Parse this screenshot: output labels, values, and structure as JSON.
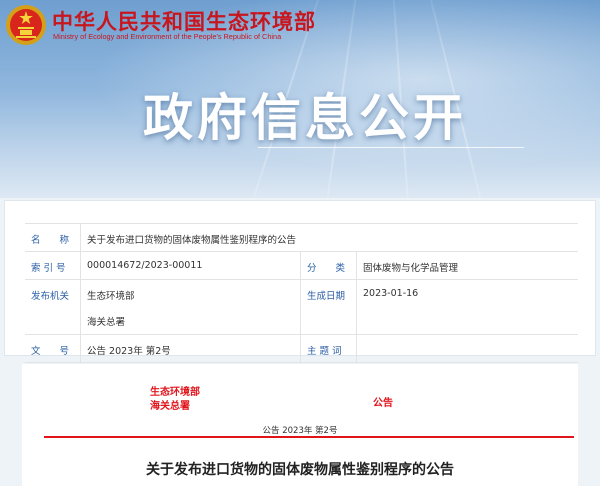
{
  "header": {
    "ministry_cn": "中华人民共和国生态环境部",
    "ministry_en": "Ministry of Ecology and Environment of the People's Republic of China",
    "section_title": "政府信息公开"
  },
  "meta": {
    "labels": {
      "name": "名　　称",
      "index": "索 引 号",
      "category": "分　　类",
      "issuer": "发布机关",
      "date": "生成日期",
      "doc_no": "文　　号",
      "subject": "主 题 词"
    },
    "values": {
      "name": "关于发布进口货物的固体废物属性鉴别程序的公告",
      "index": "000014672/2023-00011",
      "category": "固体废物与化学品管理",
      "issuer_1": "生态环境部",
      "issuer_2": "海关总署",
      "date": "2023-01-16",
      "doc_no": "公告 2023年 第2号",
      "subject": ""
    }
  },
  "document": {
    "issuer_1": "生态环境部",
    "issuer_2": "海关总署",
    "announce_word": "公告",
    "number": "公告 2023年 第2号",
    "title": "关于发布进口货物的固体废物属性鉴别程序的公告"
  },
  "colors": {
    "brand_red": "#c8161e",
    "label_blue": "#2b5fa6"
  }
}
